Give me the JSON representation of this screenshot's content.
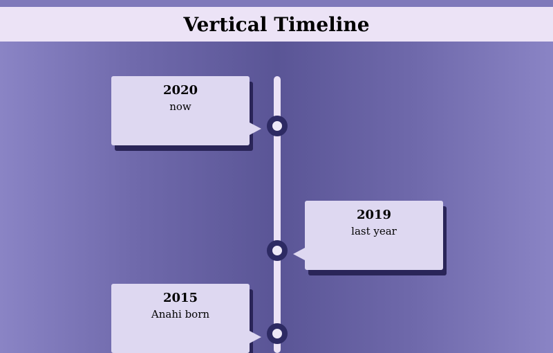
{
  "title": "Vertical Timeline",
  "events": [
    {
      "year": "2020",
      "text": "now"
    },
    {
      "year": "2019",
      "text": "last year"
    },
    {
      "year": "2015",
      "text": "Anahi born"
    }
  ]
}
